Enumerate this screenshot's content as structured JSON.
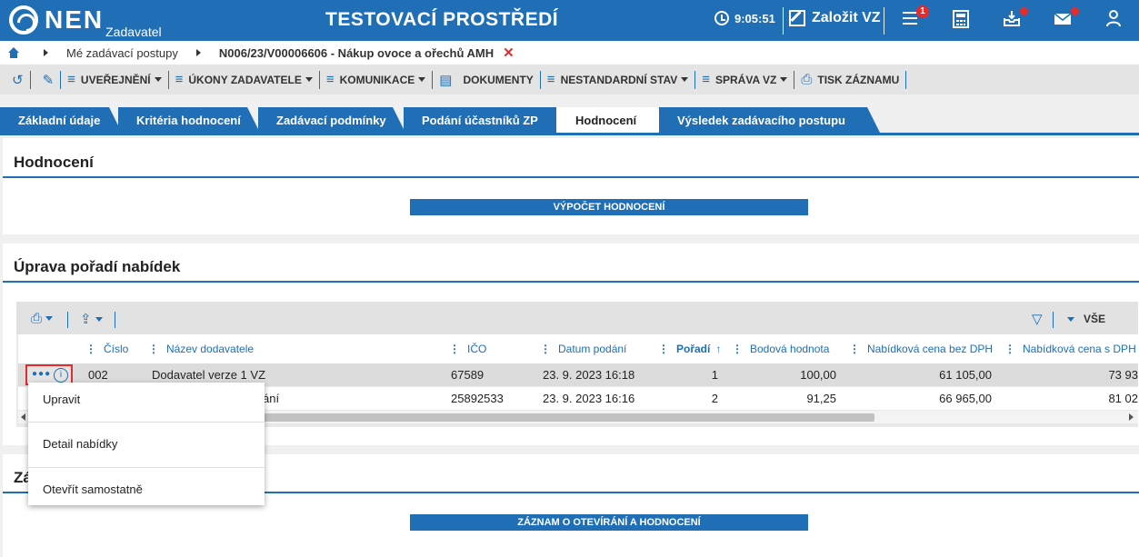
{
  "topbar": {
    "logo_text": "NEN",
    "logo_sub": "Zadavatel",
    "env_title": "TESTOVACÍ PROSTŘEDÍ",
    "clock": "9:05:51",
    "create_vz": "Založit VZ",
    "menu_badge": "1",
    "icons": [
      "clock-icon",
      "edit-icon",
      "menu-icon",
      "calculator-icon",
      "inbox-icon",
      "mail-icon",
      "user-icon"
    ],
    "accent": "#1f6eb6",
    "alert": "#e52b2b"
  },
  "breadcrumb": {
    "items": [
      "Mé zadávací postupy",
      "N006/23/V00006606 - Nákup ovoce a ořechů AMH"
    ]
  },
  "toolbar": {
    "items": [
      "UVEŘEJNĚNÍ",
      "ÚKONY ZADAVATELE",
      "KOMUNIKACE",
      "DOKUMENTY",
      "NESTANDARDNÍ STAV",
      "SPRÁVA VZ",
      "TISK ZÁZNAMU"
    ]
  },
  "tabs": [
    "Základní údaje",
    "Kritéria hodnocení",
    "Zadávací podmínky",
    "Podání účastníků ZP",
    "Hodnocení",
    "Výsledek zadávacího postupu"
  ],
  "active_tab": "Hodnocení",
  "section_hodnoceni": {
    "title": "Hodnocení",
    "button": "VÝPOČET HODNOCENÍ"
  },
  "section_poradi": {
    "title": "Úprava pořadí nabídek",
    "filter_label": "VŠE",
    "columns": [
      "Číslo",
      "Název dodavatele",
      "IČO",
      "Datum podání",
      "Pořadí",
      "Bodová hodnota",
      "Nabídková cena bez DPH",
      "Nabídková cena s DPH"
    ],
    "rows": [
      {
        "cislo": "002",
        "nazev": "Dodavatel verze 1 VZ",
        "ico": "67589",
        "datum": "23. 9. 2023 16:18",
        "poradi": "1",
        "body": "100,00",
        "cena_bez": "61 105,00",
        "cena_s": "73 93"
      },
      {
        "cislo": "",
        "nazev": "ání",
        "ico": "25892533",
        "datum": "23. 9. 2023 16:16",
        "poradi": "2",
        "body": "91,25",
        "cena_bez": "66 965,00",
        "cena_s": "81 02"
      }
    ]
  },
  "section_zaznam": {
    "title_partial": "Zá",
    "button": "ZÁZNAM O OTEVÍRÁNÍ A HODNOCENÍ"
  },
  "context_menu": {
    "items": [
      "Upravit",
      "Detail nabídky",
      "Otevřít samostatně"
    ]
  }
}
